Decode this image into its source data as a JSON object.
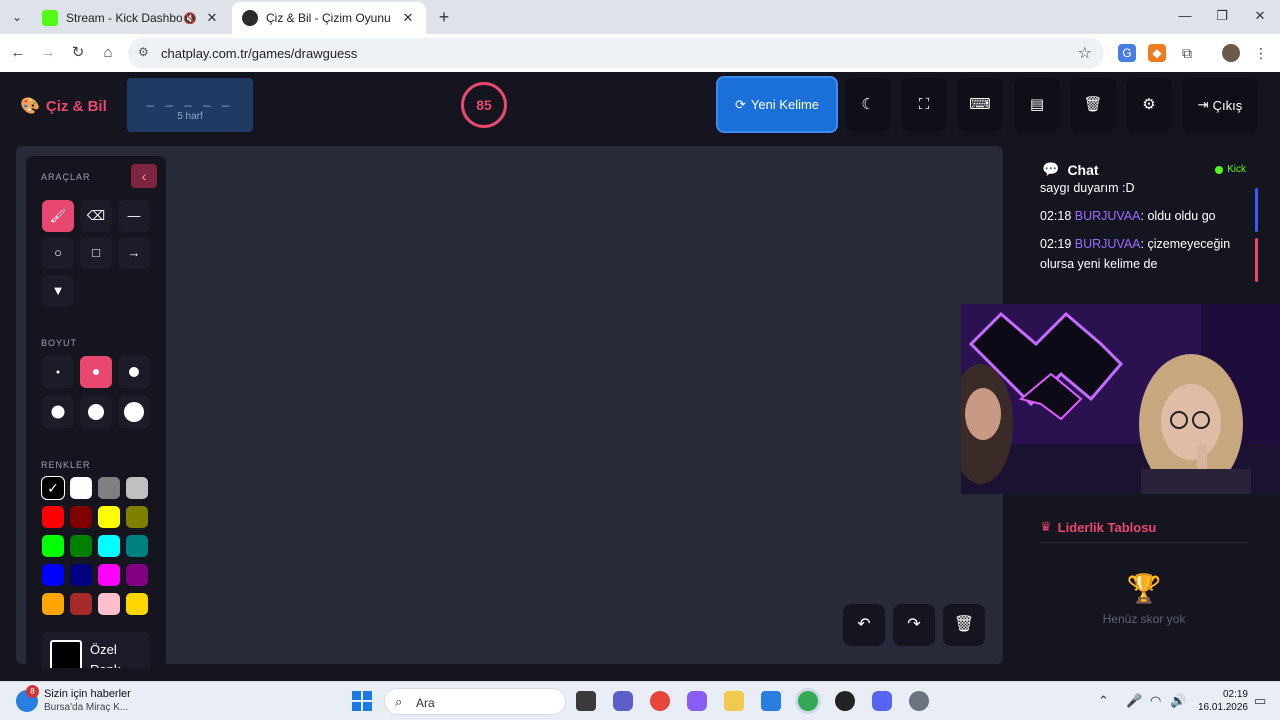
{
  "browser": {
    "tabs": [
      {
        "title": "Stream - Kick Dashboard",
        "favicon_color": "#53fc18"
      },
      {
        "title": "Çiz & Bil - Çizim Oyunu",
        "favicon_color": "#2b2b2b"
      }
    ],
    "url": "chatplay.com.tr/games/drawguess"
  },
  "header": {
    "brand": "Çiz & Bil",
    "word_blanks": "_ _ _ _ _",
    "letter_count": "5 harf",
    "timer": "85",
    "new_word": "Yeni Kelime",
    "logout": "Çıkış"
  },
  "tools": {
    "tools_label": "ARAÇLAR",
    "size_label": "BOYUT",
    "colors_label": "RENKLER",
    "custom_color": "Özel Renk",
    "colors": [
      "#000000",
      "#ffffff",
      "#808080",
      "#c0c0c0",
      "#ff0000",
      "#800000",
      "#ffff00",
      "#808000",
      "#00ff00",
      "#008000",
      "#00ffff",
      "#008080",
      "#0000ff",
      "#000080",
      "#ff00ff",
      "#800080",
      "#ffa500",
      "#a52a2a",
      "#ffc0cb",
      "#ffd700"
    ]
  },
  "chat": {
    "title": "Chat",
    "platform": "Kick",
    "partial": "saygı duyarım :D",
    "messages": [
      {
        "time": "02:18",
        "user": "BURJUVAA",
        "text": ": oldu oldu go"
      },
      {
        "time": "02:19",
        "user": "BURJUVAA",
        "text": ": çizemeyeceğin olursa yeni kelime de"
      }
    ]
  },
  "leaderboard": {
    "title": "Liderlik Tablosu",
    "empty": "Henüz skor yok"
  },
  "taskbar": {
    "news_title": "Sizin için haberler",
    "news_sub": "Bursa'da Miraç K...",
    "news_badge": "8",
    "search": "Ara",
    "time": "02:19",
    "date": "16.01.2026"
  }
}
